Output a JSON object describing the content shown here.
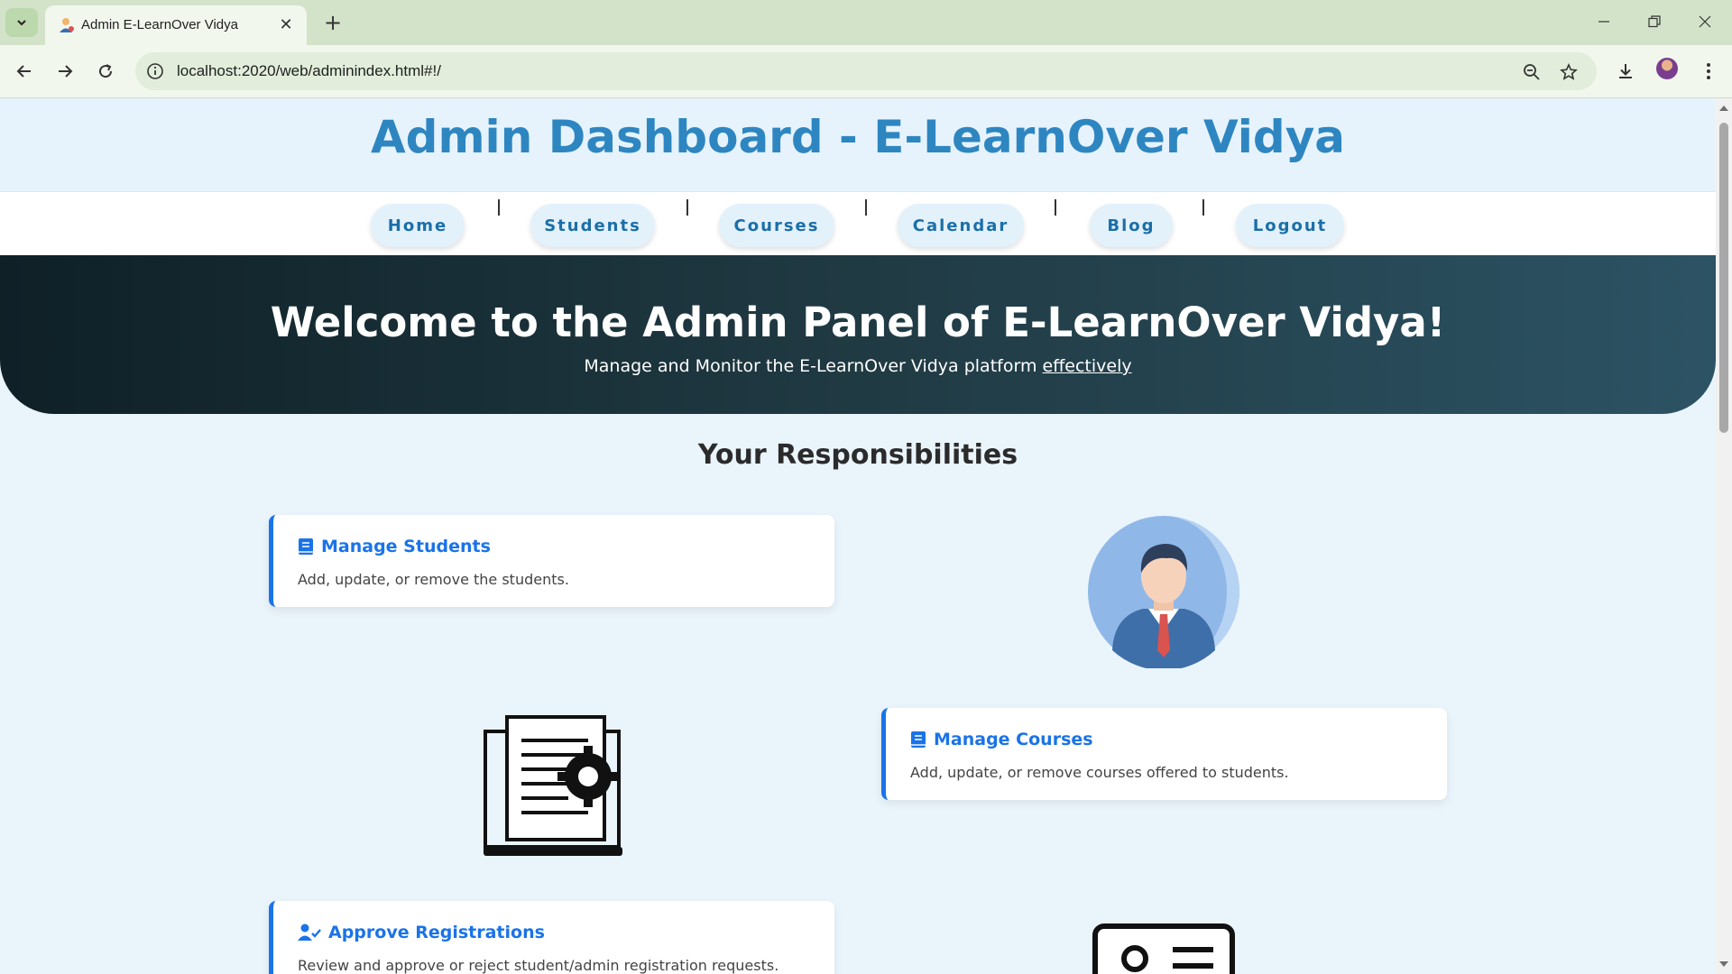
{
  "browser": {
    "tab_title": "Admin E-LearnOver Vidya",
    "url": "localhost:2020/web/adminindex.html#!/"
  },
  "page": {
    "site_title": "Admin Dashboard - E-LearnOver Vidya",
    "nav": {
      "home": "Home",
      "students": "Students",
      "courses": "Courses",
      "calendar": "Calendar",
      "blog": "Blog",
      "logout": "Logout"
    },
    "hero": {
      "title": "Welcome to the Admin Panel of E-LearnOver Vidya!",
      "subtitle_prefix": "Manage and Monitor the E-LearnOver Vidya platform ",
      "subtitle_link": "effectively"
    },
    "responsibilities": {
      "heading": "Your Responsibilities",
      "items": [
        {
          "title": "Manage Students",
          "description": "Add, update, or remove the students."
        },
        {
          "title": "Manage Courses",
          "description": "Add, update, or remove courses offered to students."
        },
        {
          "title": "Approve Registrations",
          "description": "Review and approve or reject student/admin registration requests."
        }
      ]
    }
  },
  "colors": {
    "accent": "#1a73e8",
    "title_blue": "#2e86c1",
    "hero_dark": "#0f2027",
    "hero_light": "#2c5364"
  }
}
